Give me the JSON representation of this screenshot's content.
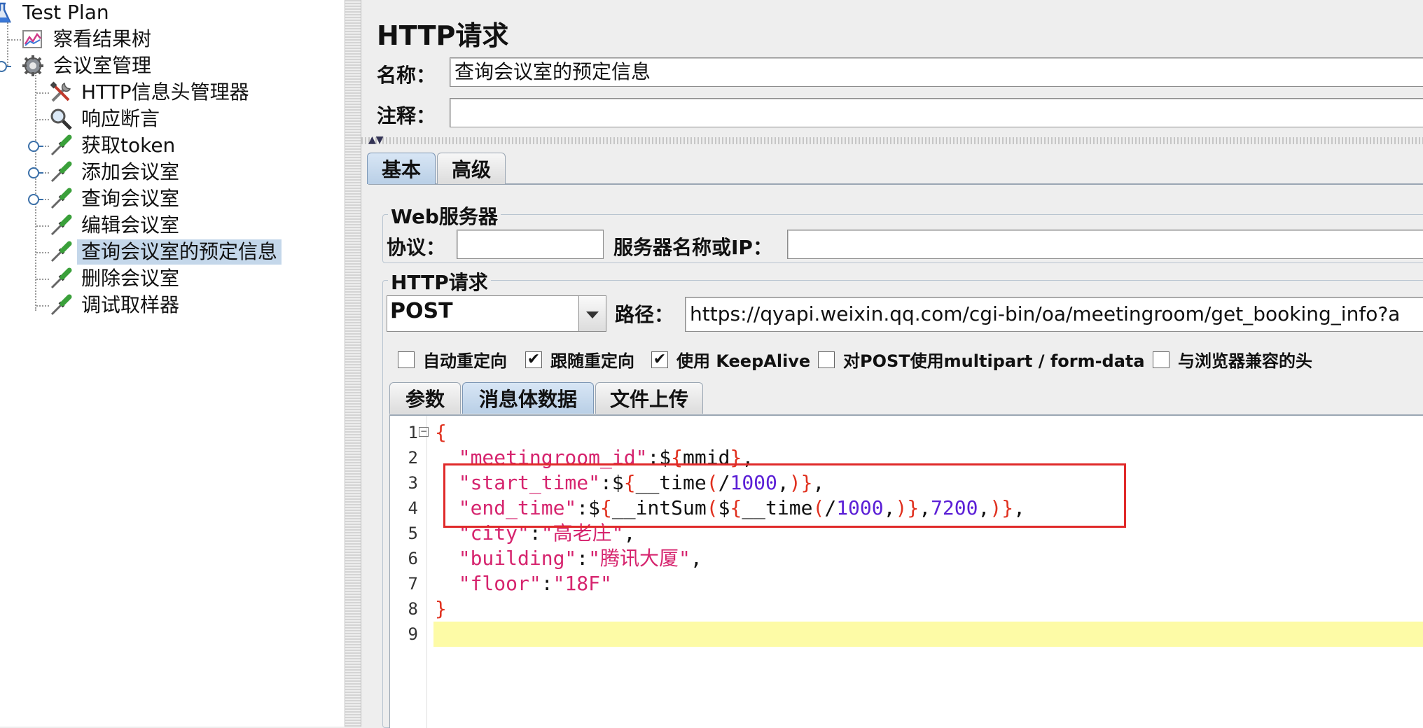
{
  "tree": {
    "root": "Test Plan",
    "items": [
      {
        "label": "察看结果树",
        "icon": "results-tree-icon"
      },
      {
        "label": "会议室管理",
        "icon": "thread-group-gear-icon"
      },
      {
        "label": "HTTP信息头管理器",
        "icon": "tools-icon"
      },
      {
        "label": "响应断言",
        "icon": "magnifier-icon"
      },
      {
        "label": "获取token",
        "icon": "sampler-pipette-icon"
      },
      {
        "label": "添加会议室",
        "icon": "sampler-pipette-icon"
      },
      {
        "label": "查询会议室",
        "icon": "sampler-pipette-icon"
      },
      {
        "label": "编辑会议室",
        "icon": "sampler-pipette-icon"
      },
      {
        "label": "查询会议室的预定信息",
        "icon": "sampler-pipette-icon",
        "selected": true
      },
      {
        "label": "删除会议室",
        "icon": "sampler-pipette-icon"
      },
      {
        "label": "调试取样器",
        "icon": "sampler-pipette-icon"
      }
    ]
  },
  "panel": {
    "title": "HTTP请求",
    "name_label": "名称：",
    "name_value": "查询会议室的预定信息",
    "comment_label": "注释：",
    "comment_value": "",
    "tabs": [
      "基本",
      "高级"
    ],
    "web_server": {
      "group_title": "Web服务器",
      "protocol_label": "协议：",
      "protocol_value": "",
      "server_label": "服务器名称或IP：",
      "server_value": ""
    },
    "http_request": {
      "group_title": "HTTP请求",
      "method": "POST",
      "path_label": "路径：",
      "path_value": "https://qyapi.weixin.qq.com/cgi-bin/oa/meetingroom/get_booking_info?a"
    },
    "checkboxes": [
      {
        "label": "自动重定向",
        "checked": false
      },
      {
        "label": "跟随重定向",
        "checked": true
      },
      {
        "label": "使用 KeepAlive",
        "checked": true
      },
      {
        "label": "对POST使用multipart / form-data",
        "checked": false
      },
      {
        "label": "与浏览器兼容的头",
        "checked": false
      }
    ],
    "check_mark": "✔",
    "subtabs": [
      "参数",
      "消息体数据",
      "文件上传"
    ],
    "body_lines": [
      {
        "num": "1",
        "tokens": [
          {
            "t": "{",
            "c": "brace"
          }
        ]
      },
      {
        "num": "2",
        "tokens": [
          {
            "t": "  ",
            "c": "plain"
          },
          {
            "t": "\"meetingroom_id\"",
            "c": "str"
          },
          {
            "t": ":$",
            "c": "plain"
          },
          {
            "t": "{",
            "c": "brace"
          },
          {
            "t": "mmid",
            "c": "plain"
          },
          {
            "t": "}",
            "c": "brace"
          },
          {
            "t": ",",
            "c": "plain"
          }
        ]
      },
      {
        "num": "3",
        "tokens": [
          {
            "t": "  ",
            "c": "plain"
          },
          {
            "t": "\"start_time\"",
            "c": "str"
          },
          {
            "t": ":$",
            "c": "plain"
          },
          {
            "t": "{",
            "c": "brace"
          },
          {
            "t": "__time",
            "c": "plain"
          },
          {
            "t": "(",
            "c": "brace"
          },
          {
            "t": "/",
            "c": "plain"
          },
          {
            "t": "1000",
            "c": "num"
          },
          {
            "t": ",",
            "c": "plain"
          },
          {
            "t": ")",
            "c": "brace"
          },
          {
            "t": "}",
            "c": "brace"
          },
          {
            "t": ",",
            "c": "plain"
          }
        ]
      },
      {
        "num": "4",
        "tokens": [
          {
            "t": "  ",
            "c": "plain"
          },
          {
            "t": "\"end_time\"",
            "c": "str"
          },
          {
            "t": ":$",
            "c": "plain"
          },
          {
            "t": "{",
            "c": "brace"
          },
          {
            "t": "__intSum",
            "c": "plain"
          },
          {
            "t": "(",
            "c": "brace"
          },
          {
            "t": "$",
            "c": "plain"
          },
          {
            "t": "{",
            "c": "brace"
          },
          {
            "t": "__time",
            "c": "plain"
          },
          {
            "t": "(",
            "c": "brace"
          },
          {
            "t": "/",
            "c": "plain"
          },
          {
            "t": "1000",
            "c": "num"
          },
          {
            "t": ",",
            "c": "plain"
          },
          {
            "t": ")",
            "c": "brace"
          },
          {
            "t": "}",
            "c": "brace"
          },
          {
            "t": ",",
            "c": "plain"
          },
          {
            "t": "7200",
            "c": "num"
          },
          {
            "t": ",",
            "c": "plain"
          },
          {
            "t": ")",
            "c": "brace"
          },
          {
            "t": "}",
            "c": "brace"
          },
          {
            "t": ",",
            "c": "plain"
          }
        ]
      },
      {
        "num": "5",
        "tokens": [
          {
            "t": "  ",
            "c": "plain"
          },
          {
            "t": "\"city\"",
            "c": "str"
          },
          {
            "t": ":",
            "c": "plain"
          },
          {
            "t": "\"高老庄\"",
            "c": "str"
          },
          {
            "t": ",",
            "c": "plain"
          }
        ]
      },
      {
        "num": "6",
        "tokens": [
          {
            "t": "  ",
            "c": "plain"
          },
          {
            "t": "\"building\"",
            "c": "str"
          },
          {
            "t": ":",
            "c": "plain"
          },
          {
            "t": "\"腾讯大厦\"",
            "c": "str"
          },
          {
            "t": ",",
            "c": "plain"
          }
        ]
      },
      {
        "num": "7",
        "tokens": [
          {
            "t": "  ",
            "c": "plain"
          },
          {
            "t": "\"floor\"",
            "c": "str"
          },
          {
            "t": ":",
            "c": "plain"
          },
          {
            "t": "\"18F\"",
            "c": "str"
          }
        ]
      },
      {
        "num": "8",
        "tokens": [
          {
            "t": "}",
            "c": "brace"
          }
        ]
      },
      {
        "num": "9",
        "tokens": []
      }
    ],
    "fold_glyph": "−",
    "colors": {
      "selected_row": "#c4d7ea",
      "highlight_line": "#fdfba6",
      "annotation_box": "#e02a2a",
      "string": "#d6246e",
      "brace": "#e0301e",
      "number": "#5b1fd6"
    }
  }
}
